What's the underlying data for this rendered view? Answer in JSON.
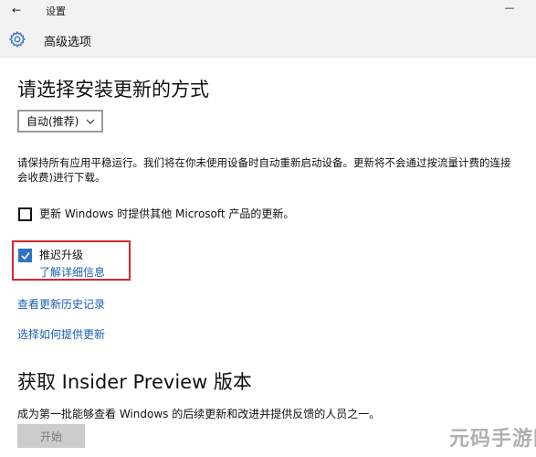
{
  "titlebar": {
    "back_glyph": "←",
    "app_title": "设置",
    "minimize_glyph": "—"
  },
  "header": {
    "title": "高级选项",
    "icon": "gear-icon"
  },
  "install": {
    "heading": "请选择安装更新的方式",
    "select_value": "自动(推荐)",
    "description_line1": "请保持所有应用平稳运行。我们将在你未使用设备时自动重新启动设备。更新将不会通过按流量计费的连接",
    "description_line2": "会收费)进行下载。"
  },
  "options": {
    "other_products_label": "更新 Windows 时提供其他 Microsoft 产品的更新。",
    "other_products_checked": false,
    "defer_label": "推迟升级",
    "defer_checked": true,
    "defer_link": "了解详细信息"
  },
  "links": {
    "history": "查看更新历史记录",
    "delivery": "选择如何提供更新"
  },
  "insider": {
    "heading": "获取 Insider Preview 版本",
    "description": "成为第一批能够查看 Windows 的后续更新和改进并提供反馈的人员之一。",
    "button": "开始"
  },
  "watermark": "元码手游网",
  "colors": {
    "accent": "#2f72c2",
    "link": "#1a5fb4",
    "highlight": "#d9282e"
  }
}
